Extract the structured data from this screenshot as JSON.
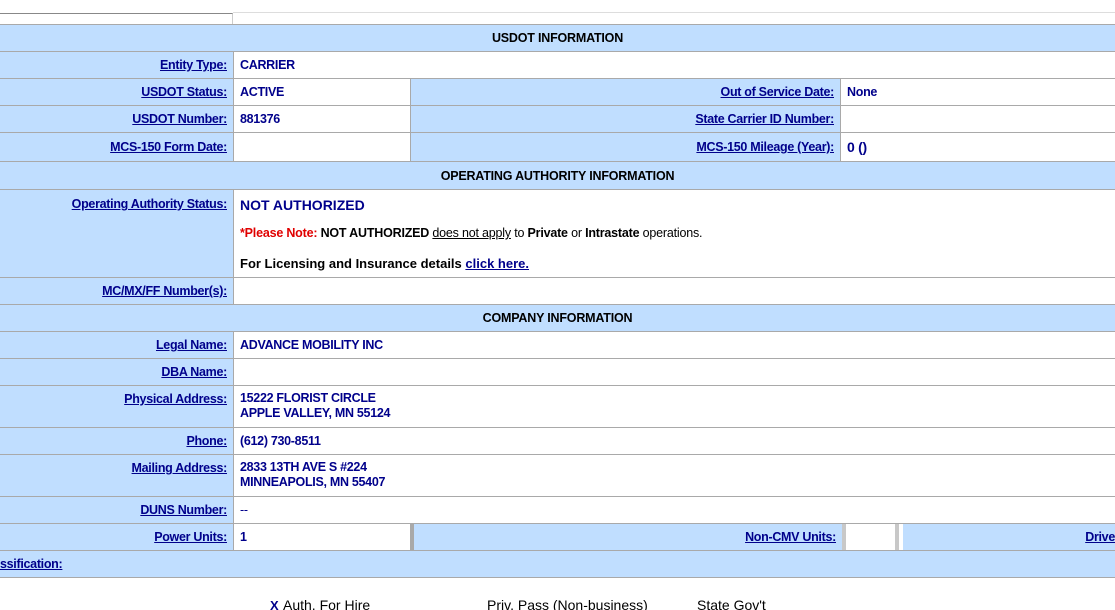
{
  "sections": {
    "usdot": "USDOT INFORMATION",
    "authority": "OPERATING AUTHORITY INFORMATION",
    "company": "COMPANY INFORMATION"
  },
  "usdot": {
    "entity_type_label": "Entity Type:",
    "entity_type": "CARRIER",
    "status_label": "USDOT Status:",
    "status": "ACTIVE",
    "oos_label": "Out of Service Date:",
    "oos": "None",
    "number_label": "USDOT Number:",
    "number": "881376",
    "state_id_label": "State Carrier ID Number:",
    "state_id": "",
    "mcs_date_label": "MCS-150 Form Date:",
    "mcs_date": "",
    "mcs_mileage_label": "MCS-150 Mileage (Year):",
    "mcs_mileage": "0 ()"
  },
  "authority": {
    "status_label": "Operating Authority Status:",
    "status": "NOT AUTHORIZED",
    "note_prefix": "*Please Note:",
    "note_status": "NOT AUTHORIZED",
    "note_link": "does not apply",
    "note_to": "to",
    "note_private": "Private",
    "note_or": "or",
    "note_intrastate": "Intrastate",
    "note_ops": "operations.",
    "licensing_text": "For Licensing and Insurance details",
    "licensing_link": "click here.",
    "mcmx_label": "MC/MX/FF Number(s):",
    "mcmx": ""
  },
  "company": {
    "legal_label": "Legal Name:",
    "legal": "ADVANCE MOBILITY INC",
    "dba_label": "DBA Name:",
    "dba": "",
    "physical_label": "Physical Address:",
    "physical_line1": "15222 FLORIST CIRCLE",
    "physical_line2": "APPLE VALLEY, MN   55124",
    "phone_label": "Phone:",
    "phone": "(612) 730-8511",
    "mailing_label": "Mailing Address:",
    "mailing_line1": "2833 13TH AVE S #224",
    "mailing_line2": "MINNEAPOLIS, MN   55407",
    "duns_label": "DUNS Number:",
    "duns": "--",
    "power_label": "Power Units:",
    "power": "1",
    "noncmv_label": "Non-CMV Units:",
    "noncmv": "",
    "drivers_label": "Drive",
    "classification_label": "ssification:"
  },
  "classification": {
    "auth_mark": "X",
    "auth": "Auth. For Hire",
    "priv_pass": "Priv. Pass (Non-business)",
    "state_govt": "State Gov't"
  }
}
